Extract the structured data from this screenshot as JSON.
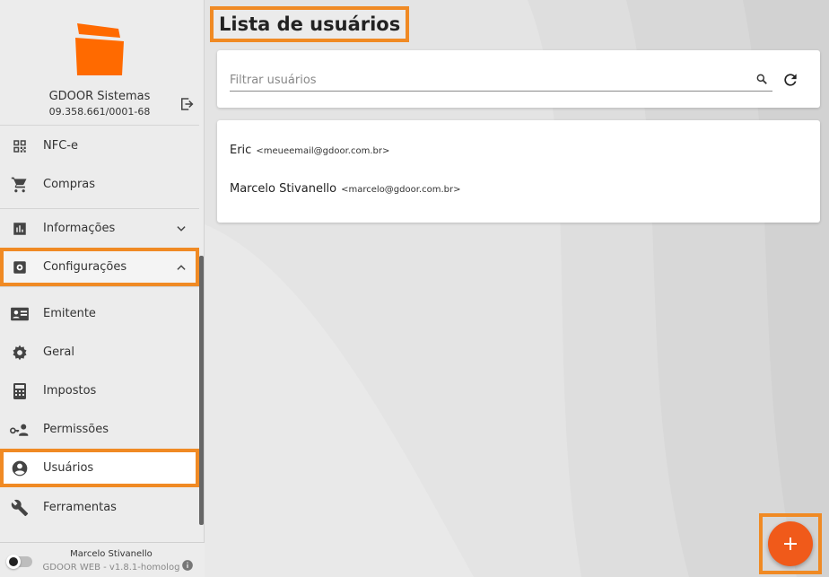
{
  "brand": {
    "company_name": "GDOOR Sistemas",
    "cnpj": "09.358.661/0001-68",
    "logo_color": "#ff6a00"
  },
  "nav": {
    "items": [
      {
        "label": "NFC-e",
        "icon": "qr-code-icon"
      },
      {
        "label": "Compras",
        "icon": "cart-icon"
      },
      {
        "label": "Informações",
        "icon": "bar-chart-icon",
        "expanded": false
      },
      {
        "label": "Configurações",
        "icon": "settings-box-icon",
        "expanded": true
      },
      {
        "label": "Emitente",
        "icon": "id-card-icon"
      },
      {
        "label": "Geral",
        "icon": "gear-icon"
      },
      {
        "label": "Impostos",
        "icon": "calculator-icon"
      },
      {
        "label": "Permissões",
        "icon": "user-key-icon"
      },
      {
        "label": "Usuários",
        "icon": "account-circle-icon",
        "active": true
      },
      {
        "label": "Ferramentas",
        "icon": "wrench-icon"
      }
    ]
  },
  "footer": {
    "user": "Marcelo Stivanello",
    "version": "GDOOR WEB - v1.8.1-homolog"
  },
  "main": {
    "title": "Lista de usuários",
    "filter_placeholder": "Filtrar usuários",
    "users": [
      {
        "name": "Eric",
        "email": "<meueemail@gdoor.com.br>"
      },
      {
        "name": "Marcelo Stivanello",
        "email": "<marcelo@gdoor.com.br>"
      }
    ],
    "fab_label": "+"
  },
  "colors": {
    "accent": "#f08a24",
    "fab": "#f05a1a"
  }
}
